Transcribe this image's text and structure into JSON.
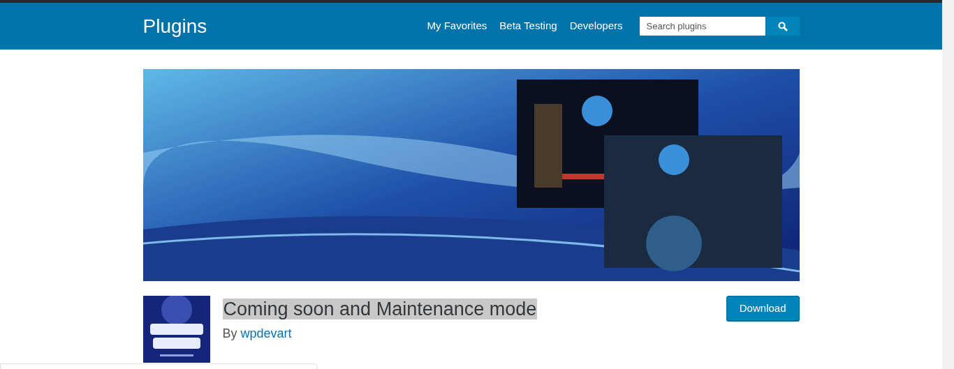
{
  "header": {
    "title": "Plugins",
    "nav": [
      {
        "label": "My Favorites"
      },
      {
        "label": "Beta Testing"
      },
      {
        "label": "Developers"
      }
    ],
    "search": {
      "placeholder": "Search plugins"
    }
  },
  "plugin": {
    "title": "Coming soon and Maintenance mode",
    "title_highlighted": true,
    "by": "By",
    "author": "wpdevart",
    "download": "Download"
  }
}
